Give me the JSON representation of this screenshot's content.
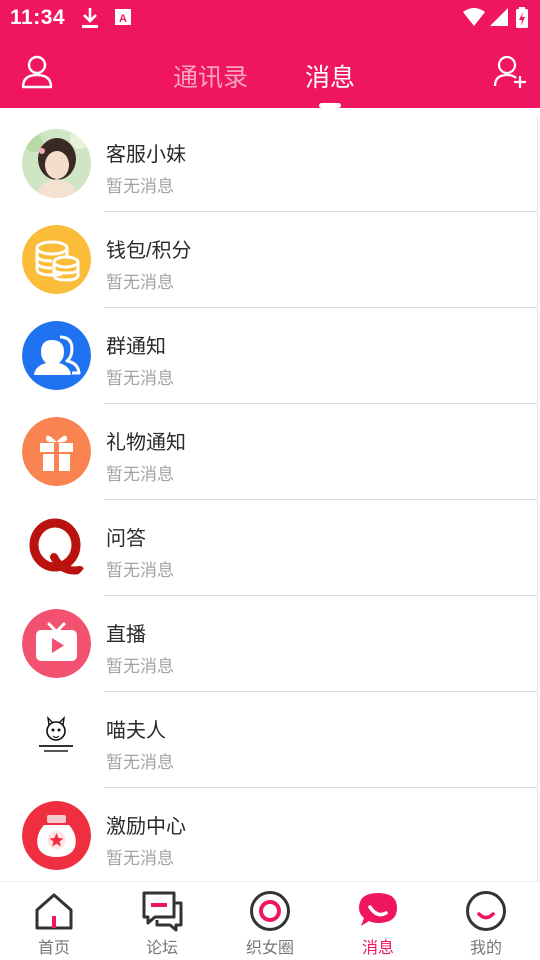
{
  "status_bar": {
    "time": "11:34",
    "icons": [
      "download-icon",
      "a-icon",
      "wifi-icon",
      "signal-icon",
      "battery-icon"
    ]
  },
  "header": {
    "left_icon": "user-icon",
    "right_icon": "add-user-icon",
    "tabs": [
      {
        "label": "通讯录",
        "active": false
      },
      {
        "label": "消息",
        "active": true
      }
    ]
  },
  "conversations": [
    {
      "name": "客服小妹",
      "preview": "暂无消息",
      "icon": "customer-service-avatar"
    },
    {
      "name": "钱包/积分",
      "preview": "暂无消息",
      "icon": "coins-icon"
    },
    {
      "name": "群通知",
      "preview": "暂无消息",
      "icon": "group-icon"
    },
    {
      "name": "礼物通知",
      "preview": "暂无消息",
      "icon": "gift-icon"
    },
    {
      "name": "问答",
      "preview": "暂无消息",
      "icon": "q-icon"
    },
    {
      "name": "直播",
      "preview": "暂无消息",
      "icon": "tv-play-icon"
    },
    {
      "name": "喵夫人",
      "preview": "暂无消息",
      "icon": "cat-logo-icon"
    },
    {
      "name": "激励中心",
      "preview": "暂无消息",
      "icon": "reward-bag-icon"
    }
  ],
  "bottom_nav": [
    {
      "label": "首页",
      "icon": "home-icon",
      "active": false
    },
    {
      "label": "论坛",
      "icon": "forum-icon",
      "active": false
    },
    {
      "label": "织女圈",
      "icon": "circle-icon",
      "active": false
    },
    {
      "label": "消息",
      "icon": "message-icon",
      "active": true
    },
    {
      "label": "我的",
      "icon": "smile-icon",
      "active": false
    }
  ],
  "colors": {
    "brand": "#ef1561",
    "inactive_tab": "#f9a3c2",
    "preview_text": "#a3a3a3"
  }
}
